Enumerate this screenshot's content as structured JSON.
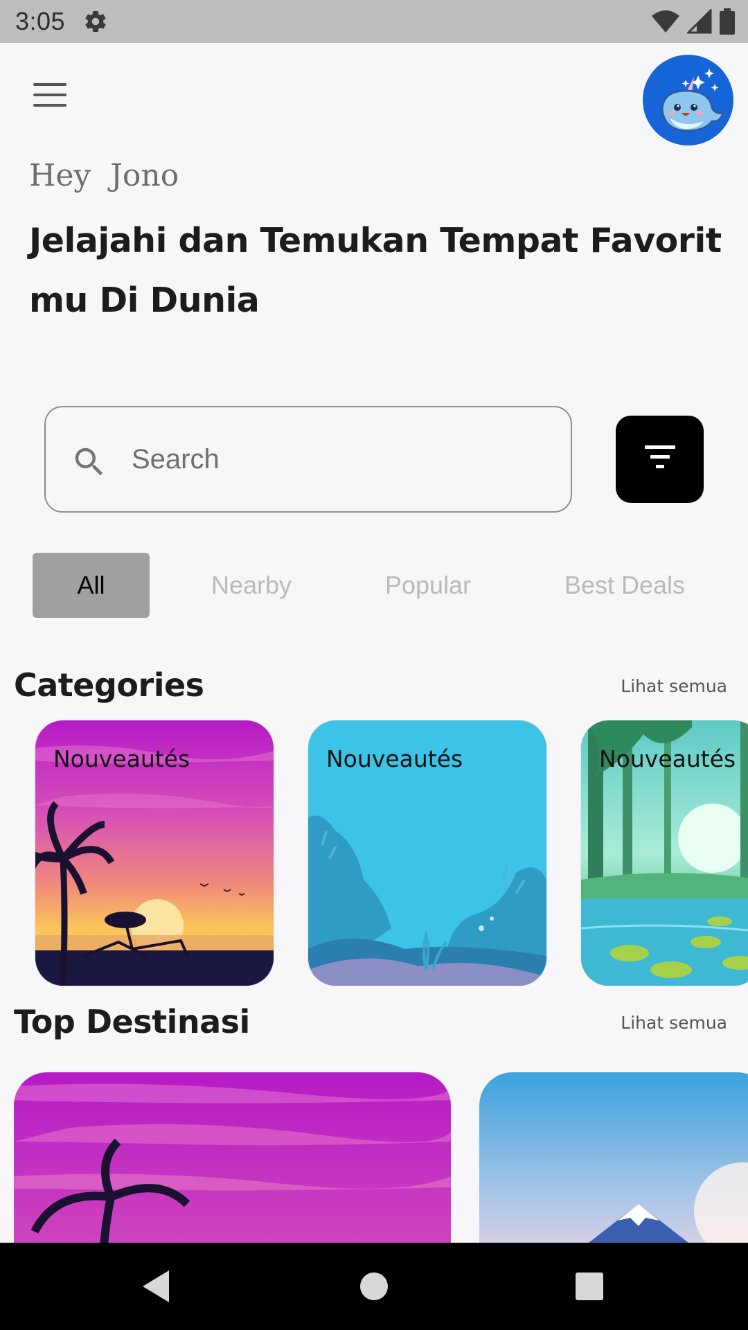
{
  "status_bar": {
    "time": "3:05",
    "icons": [
      "settings-icon",
      "wifi-icon",
      "cell-signal-icon",
      "battery-icon"
    ]
  },
  "header": {
    "menu_icon": "hamburger-menu-icon",
    "avatar_icon": "narwhal-avatar",
    "greeting": "Hey  Jono",
    "headline": "Jelajahi dan Temukan Tempat Favorit mu Di Dunia"
  },
  "search": {
    "placeholder": "Search",
    "value": "",
    "filter_icon": "filter-icon"
  },
  "tabs": [
    {
      "label": "All",
      "active": true
    },
    {
      "label": "Nearby",
      "active": false
    },
    {
      "label": "Popular",
      "active": false
    },
    {
      "label": "Best Deals",
      "active": false
    }
  ],
  "categories": {
    "title": "Categories",
    "see_all": "Lihat semua",
    "items": [
      {
        "label": "Nouveautés",
        "scene": "sunset-beach"
      },
      {
        "label": "Nouveautés",
        "scene": "underwater"
      },
      {
        "label": "Nouveautés",
        "scene": "forest-lake"
      }
    ]
  },
  "top_destinations": {
    "title": "Top Destinasi",
    "see_all": "Lihat semua",
    "items": [
      {
        "scene": "sunset-beach"
      },
      {
        "scene": "snowy-mountain"
      }
    ]
  },
  "nav_bar": {
    "buttons": [
      "back-icon",
      "home-icon",
      "recents-icon"
    ]
  },
  "colors": {
    "status_bar": "#bdbdbd",
    "background": "#f7f7f9",
    "avatar": "#1565d8",
    "active_tab": "#a0a0a0",
    "filter_button": "#000000"
  }
}
